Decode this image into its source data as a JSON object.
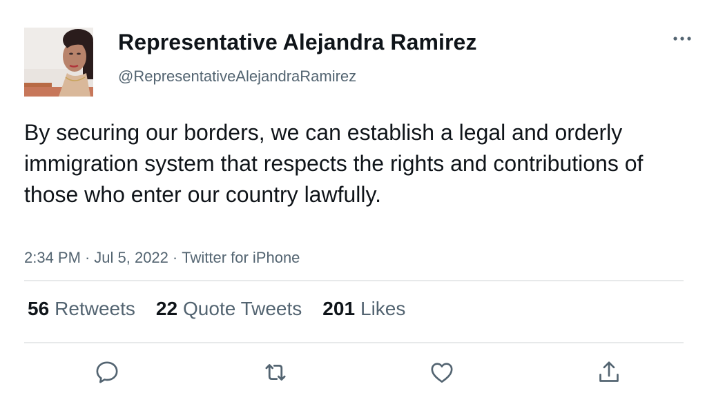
{
  "author": {
    "display_name": "Representative Alejandra Ramirez",
    "handle": "@RepresentativeAlejandraRamirez"
  },
  "tweet": {
    "text": "By securing our borders, we can establish a legal and orderly immigration system that respects the rights and contributions of those who enter our country lawfully.",
    "time": "2:34 PM",
    "date": "Jul 5, 2022",
    "source": "Twitter for iPhone",
    "separator": "·"
  },
  "stats": {
    "retweets_count": "56",
    "retweets_label": "Retweets",
    "quotes_count": "22",
    "quotes_label": "Quote Tweets",
    "likes_count": "201",
    "likes_label": "Likes"
  },
  "actions": [
    "reply-icon",
    "retweet-icon",
    "like-icon",
    "share-icon"
  ],
  "colors": {
    "text_primary": "#0f1419",
    "text_secondary": "#536471",
    "divider": "#e7e9ea",
    "icon": "#536471"
  }
}
